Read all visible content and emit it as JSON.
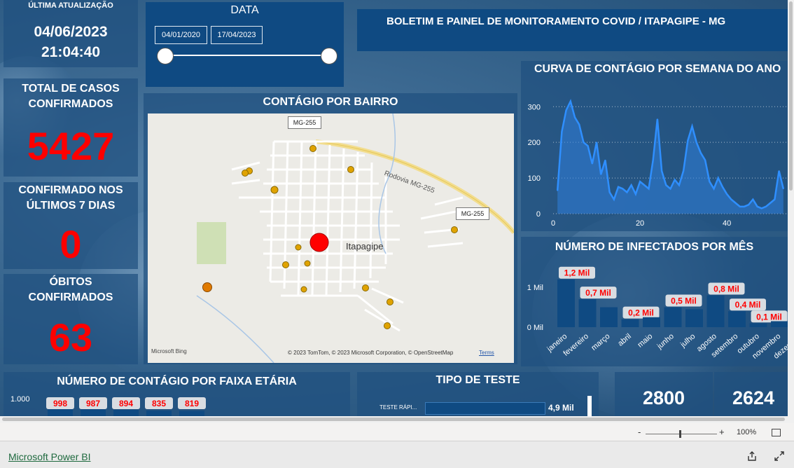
{
  "header": {
    "last_update_label": "ÚLTIMA ATUALIZAÇÃO",
    "last_update_date": "04/06/2023",
    "last_update_time": "21:04:40",
    "dashboard_title": "BOLETIM E PAINEL DE MONITORAMENTO COVID / ITAPAGIPE - MG"
  },
  "date_filter": {
    "title": "DATA",
    "start_date": "04/01/2020",
    "end_date": "17/04/2023"
  },
  "kpis": {
    "total_label_1": "TOTAL DE CASOS",
    "total_label_2": "CONFIRMADOS",
    "total_value": "5427",
    "last7_label_1": "CONFIRMADO NOS",
    "last7_label_2": "ÚLTIMOS 7 DIAS",
    "last7_value": "0",
    "deaths_label_1": "ÓBITOS",
    "deaths_label_2": "CONFIRMADOS",
    "deaths_value": "63"
  },
  "map": {
    "title": "CONTÁGIO POR BAIRRO",
    "city_label": "Itapagipe",
    "road_label_1": "MG-255",
    "road_label_2": "MG-255",
    "rodovia_label": "Rodovia MG-255",
    "bing_logo": "Microsoft Bing",
    "attribution": "© 2023 TomTom, © 2023 Microsoft Corporation, © OpenStreetMap",
    "terms": "Terms"
  },
  "weekly_chart": {
    "title": "CURVA DE CONTÁGIO POR SEMANA DO ANO",
    "chart_data": {
      "type": "area",
      "x_ticks": [
        "0",
        "20",
        "40"
      ],
      "y_ticks": [
        "0",
        "100",
        "200",
        "300"
      ],
      "ylim": [
        0,
        330
      ],
      "xlim": [
        0,
        54
      ],
      "x": [
        1,
        2,
        3,
        4,
        5,
        6,
        7,
        8,
        9,
        10,
        11,
        12,
        13,
        14,
        15,
        16,
        17,
        18,
        19,
        20,
        21,
        22,
        23,
        24,
        25,
        26,
        27,
        28,
        29,
        30,
        31,
        32,
        33,
        34,
        35,
        36,
        37,
        38,
        39,
        40,
        41,
        42,
        43,
        44,
        45,
        46,
        47,
        48,
        49,
        50,
        51,
        52,
        53
      ],
      "values": [
        65,
        230,
        290,
        315,
        270,
        250,
        200,
        190,
        140,
        200,
        110,
        150,
        60,
        40,
        75,
        70,
        60,
        80,
        55,
        90,
        80,
        70,
        150,
        265,
        120,
        80,
        70,
        95,
        80,
        120,
        205,
        245,
        200,
        170,
        150,
        90,
        70,
        100,
        75,
        55,
        40,
        30,
        20,
        20,
        25,
        40,
        20,
        15,
        20,
        30,
        40,
        120,
        70
      ]
    }
  },
  "monthly_chart": {
    "title": "NÚMERO DE INFECTADOS POR MÊS",
    "chart_data": {
      "type": "bar",
      "categories": [
        "janeiro",
        "fevereiro",
        "março",
        "abril",
        "maio",
        "junho",
        "julho",
        "agosto",
        "setembro",
        "outubro",
        "novembro",
        "dezembro"
      ],
      "values": [
        1200,
        700,
        500,
        200,
        250,
        500,
        450,
        800,
        400,
        100,
        150,
        100
      ],
      "data_labels": [
        "1,2 Mil",
        "0,7 Mil",
        "",
        "0,2 Mil",
        "",
        "0,5 Mil",
        "",
        "0,8 Mil",
        "0,4 Mil",
        "0,1 Mil",
        "",
        "0,1 Mil"
      ],
      "y_ticks": [
        "0 Mil",
        "1 Mil"
      ],
      "ylim": [
        0,
        1450
      ]
    }
  },
  "age_chart": {
    "title": "NÚMERO DE CONTÁGIO POR FAIXA ETÁRIA",
    "y_tick": "1.000",
    "chart_data": {
      "type": "bar",
      "values": [
        998,
        987,
        894,
        835,
        819
      ],
      "data_labels": [
        "998",
        "987",
        "894",
        "835",
        "819"
      ]
    }
  },
  "test_type": {
    "title": "TIPO DE TESTE",
    "chart_data": {
      "type": "bar",
      "categories": [
        "TESTE RÁPI..."
      ],
      "values": [
        4900
      ],
      "data_labels": [
        "4,9 Mil"
      ]
    }
  },
  "extra_kpis": {
    "value_1": "2800",
    "value_2": "2624"
  },
  "zoom": {
    "minus": "-",
    "plus": "+",
    "percent": "100%"
  },
  "footer": {
    "brand": "Microsoft Power BI"
  },
  "colors": {
    "panel": "#205080",
    "title_bar": "#0f4a82",
    "accent_red": "#ff0000",
    "line_blue": "#2f8fff"
  }
}
